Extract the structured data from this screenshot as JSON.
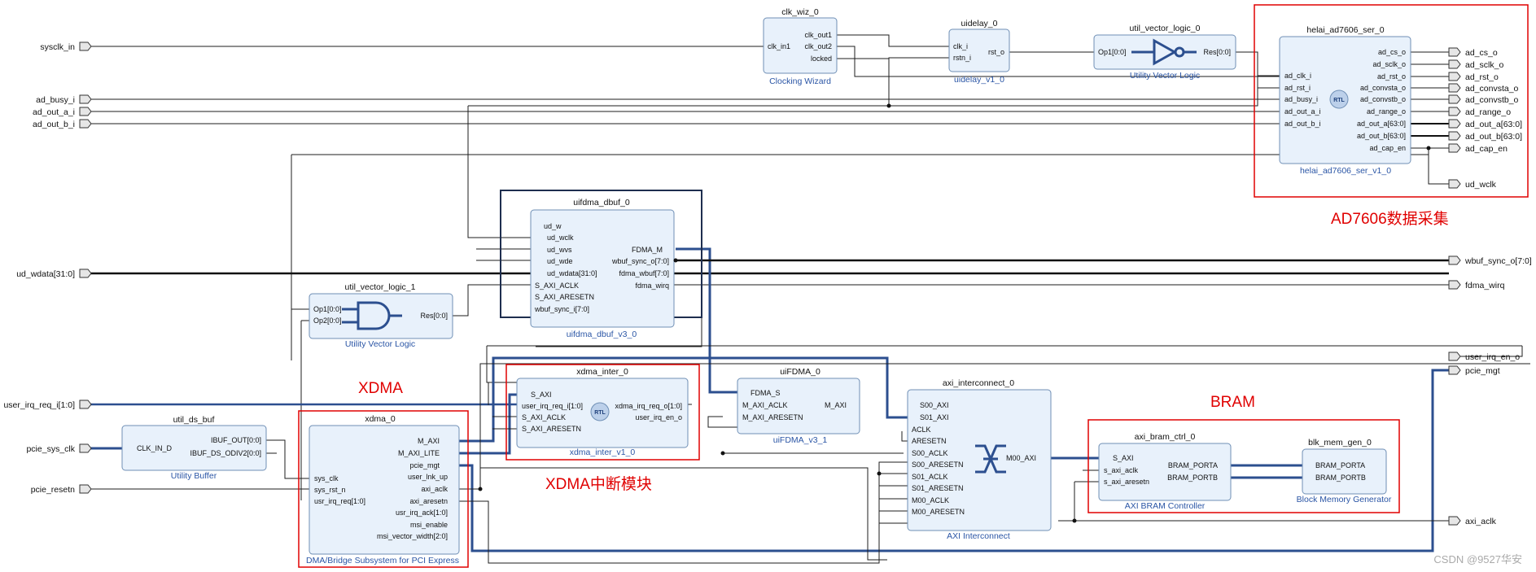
{
  "external_ports": {
    "sysclk_in": "sysclk_in",
    "ad_busy_i": "ad_busy_i",
    "ad_out_a_i": "ad_out_a_i",
    "ad_out_b_i": "ad_out_b_i",
    "ud_wdata": "ud_wdata[31:0]",
    "user_irq_req": "user_irq_req_i[1:0]",
    "pcie_sys_clk": "pcie_sys_clk",
    "pcie_resetn": "pcie_resetn",
    "ad_cs_o": "ad_cs_o",
    "ad_sclk_o": "ad_sclk_o",
    "ad_rst_o": "ad_rst_o",
    "ad_convsta_o": "ad_convsta_o",
    "ad_convstb_o": "ad_convstb_o",
    "ad_range_o": "ad_range_o",
    "ad_out_a": "ad_out_a[63:0]",
    "ad_out_b": "ad_out_b[63:0]",
    "ad_cap_en": "ad_cap_en",
    "ud_wclk": "ud_wclk",
    "wbuf_sync_o": "wbuf_sync_o[7:0]",
    "fdma_wirq": "fdma_wirq",
    "user_irq_en_o": "user_irq_en_o",
    "pcie_mgt": "pcie_mgt",
    "axi_aclk": "axi_aclk"
  },
  "blocks": {
    "clk_wiz": {
      "name": "clk_wiz_0",
      "sub": "Clocking Wizard",
      "in": [
        "clk_in1"
      ],
      "out": [
        "clk_out1",
        "clk_out2",
        "locked"
      ]
    },
    "uidelay": {
      "name": "uidelay_0",
      "sub": "uidelay_v1_0",
      "in": [
        "clk_i",
        "rstn_i"
      ],
      "out": [
        "rst_o"
      ]
    },
    "util_vector_logic_0": {
      "name": "util_vector_logic_0",
      "sub": "Utility Vector Logic",
      "in": [
        "Op1[0:0]"
      ],
      "out": [
        "Res[0:0]"
      ]
    },
    "helai": {
      "name": "helai_ad7606_ser_0",
      "sub": "helai_ad7606_ser_v1_0",
      "in": [
        "ad_clk_i",
        "ad_rst_i",
        "ad_busy_i",
        "ad_out_a_i",
        "ad_out_b_i"
      ],
      "out": [
        "ad_cs_o",
        "ad_sclk_o",
        "ad_rst_o",
        "ad_convsta_o",
        "ad_convstb_o",
        "ad_range_o",
        "ad_out_a[63:0]",
        "ad_out_b[63:0]",
        "ad_cap_en"
      ]
    },
    "uifdma_dbuf": {
      "name": "uifdma_dbuf_0",
      "sub": "uifdma_dbuf_v3_0",
      "in": [
        "ud_w",
        "ud_wclk",
        "ud_wvs",
        "ud_wde",
        "ud_wdata[31:0]",
        "S_AXI_ACLK",
        "S_AXI_ARESETN",
        "wbuf_sync_i[7:0]"
      ],
      "out": [
        "FDMA_M",
        "wbuf_sync_o[7:0]",
        "fdma_wbuf[7:0]",
        "fdma_wirq"
      ]
    },
    "util_vector_logic_1": {
      "name": "util_vector_logic_1",
      "sub": "Utility Vector Logic",
      "in": [
        "Op1[0:0]",
        "Op2[0:0]"
      ],
      "out": [
        "Res[0:0]"
      ]
    },
    "xdma_inter": {
      "name": "xdma_inter_0",
      "sub": "xdma_inter_v1_0",
      "in": [
        "S_AXI",
        "user_irq_req_i[1:0]",
        "S_AXI_ACLK",
        "S_AXI_ARESETN"
      ],
      "out": [
        "xdma_irq_req_o[1:0]",
        "user_irq_en_o"
      ]
    },
    "uiFDMA": {
      "name": "uiFDMA_0",
      "sub": "uiFDMA_v3_1",
      "in": [
        "FDMA_S",
        "M_AXI_ACLK",
        "M_AXI_ARESETN"
      ],
      "out": [
        "M_AXI"
      ]
    },
    "axi_interconnect": {
      "name": "axi_interconnect_0",
      "sub": "AXI Interconnect",
      "in": [
        "S00_AXI",
        "S01_AXI",
        "ACLK",
        "ARESETN",
        "S00_ACLK",
        "S00_ARESETN",
        "S01_ACLK",
        "S01_ARESETN",
        "M00_ACLK",
        "M00_ARESETN"
      ],
      "out": [
        "M00_AXI"
      ]
    },
    "util_ds_buf": {
      "name": "util_ds_buf",
      "sub": "Utility Buffer",
      "in": [
        "CLK_IN_D"
      ],
      "out": [
        "IBUF_OUT[0:0]",
        "IBUF_DS_ODIV2[0:0]"
      ]
    },
    "xdma": {
      "name": "xdma_0",
      "sub": "DMA/Bridge Subsystem for PCI Express",
      "in": [
        "sys_clk",
        "sys_rst_n",
        "usr_irq_req[1:0]"
      ],
      "out": [
        "M_AXI",
        "M_AXI_LITE",
        "pcie_mgt",
        "user_lnk_up",
        "axi_aclk",
        "axi_aresetn",
        "usr_irq_ack[1:0]",
        "msi_enable",
        "msi_vector_width[2:0]"
      ]
    },
    "axi_bram_ctrl": {
      "name": "axi_bram_ctrl_0",
      "sub": "AXI BRAM Controller",
      "in": [
        "S_AXI",
        "s_axi_aclk",
        "s_axi_aresetn"
      ],
      "out": [
        "BRAM_PORTA",
        "BRAM_PORTB"
      ]
    },
    "blk_mem_gen": {
      "name": "blk_mem_gen_0",
      "sub": "Block Memory Generator",
      "in": [
        "BRAM_PORTA",
        "BRAM_PORTB"
      ]
    }
  },
  "annotations": {
    "ad7606": "AD7606数据采集",
    "xdma": "XDMA",
    "xdma_irq": "XDMA中断模块",
    "bram": "BRAM"
  },
  "icons": {
    "rtl": "RTL"
  },
  "watermark": "CSDN @9527华安",
  "colors": {
    "block_fill": "#e8f1fb",
    "block_stroke": "#6f8fb5",
    "bus": "#2c4f8f",
    "annotation": "#e00000"
  }
}
